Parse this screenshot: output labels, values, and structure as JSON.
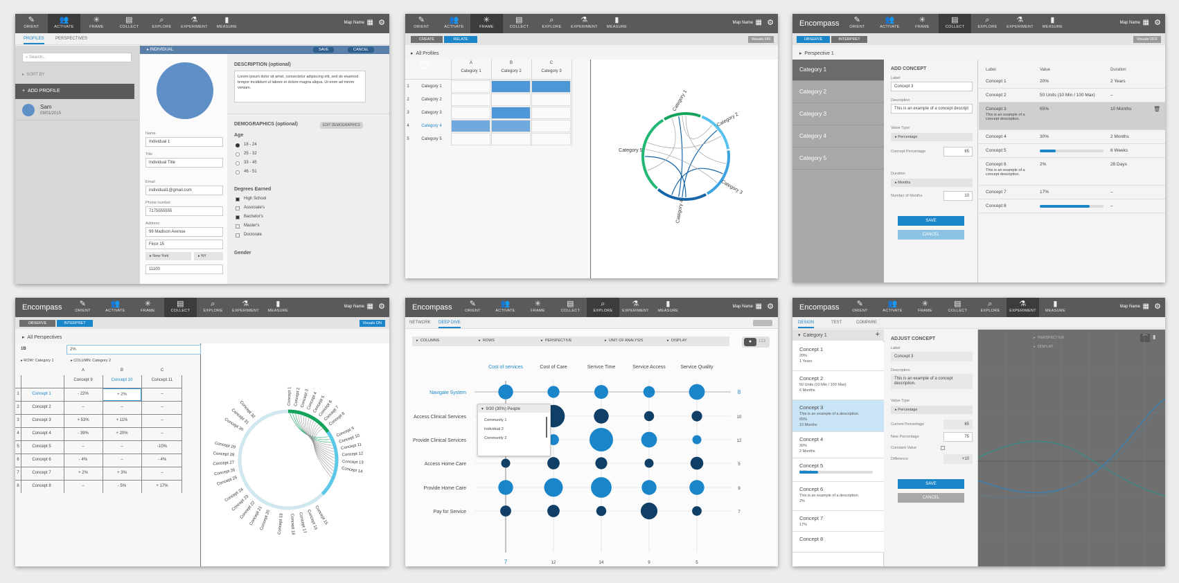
{
  "brand": "Encompass",
  "map_name": "Map Name",
  "tools": [
    "ORIENT",
    "ACTIVATE",
    "FRAME",
    "COLLECT",
    "EXPLORE",
    "EXPERIMENT",
    "MEASURE"
  ],
  "p1": {
    "tabs": [
      "PROFILES",
      "PERSPECTIVES"
    ],
    "search_placeholder": "Search...",
    "sort_by": "SORT BY",
    "add_profile": "ADD PROFILE",
    "profile_name": "Sam",
    "profile_date": "09/01/2015",
    "header": "INDIVIDUAL",
    "save": "SAVE",
    "cancel": "CANCEL",
    "name_label": "Name",
    "name_value": "Individual 1",
    "title_label": "Title",
    "title_value": "Individual Title",
    "email_label": "Email",
    "email_value": "individual1@gmail.com",
    "phone_label": "Phone number",
    "phone_value": "7175555555",
    "address_label": "Address",
    "address1": "99 Madison Avenue",
    "address2": "Floor 15",
    "city": "New York",
    "state": "NY",
    "zip": "11100",
    "desc_label": "DESCRIPTION (optional)",
    "desc_text": "Lorem ipsum dolor sit amet, consectetur adipiscing elit, sed do eiusmod tempor incididunt ut labore et dolore magna aliqua. Ut enim ad minim veniam.",
    "demo_label": "DEMOGRAPHICS (optional)",
    "edit_demo": "EDIT DEMOGRAPHICS",
    "age_label": "Age",
    "ages": [
      "18 - 24",
      "25 - 32",
      "33 - 45",
      "46 - 51"
    ],
    "degrees_label": "Degrees Earned",
    "degrees": [
      "High School",
      "Associate's",
      "Bachelor's",
      "Master's",
      "Doctorate"
    ],
    "gender_label": "Gender"
  },
  "p2": {
    "steps": [
      "CREATE",
      "RELATE"
    ],
    "visuals": "Visuals ON",
    "all_profiles": "All Profiles",
    "cols": [
      "A",
      "B",
      "C"
    ],
    "col_names": [
      "Category 1",
      "Category 2",
      "Category 3"
    ],
    "rows": [
      "Category 1",
      "Category 2",
      "Category 3",
      "Category 4",
      "Category 5"
    ],
    "row_nums": [
      "1",
      "2",
      "3",
      "4",
      "5"
    ],
    "chord_labels": [
      "Category 1",
      "Category 2",
      "Category 3",
      "Category 4",
      "Category 5"
    ]
  },
  "p3": {
    "steps": [
      "OBSERVE",
      "INTERPRET"
    ],
    "visuals": "Visuals OFF",
    "perspective": "Perspective 1",
    "categories": [
      "Category 1",
      "Category 2",
      "Category 3",
      "Category 4",
      "Category 5"
    ],
    "add_concept": "ADD CONCEPT",
    "label_label": "Label",
    "label_value": "Concept 3",
    "desc_label": "Description",
    "desc_value": "This is an example of a concept descript",
    "vt_label": "Value Type",
    "vt_value": "Percentage",
    "cp_label": "Concept Percentage",
    "cp_value": "65",
    "dur_label": "Duration",
    "dur_value": "Months",
    "num_label": "Number of Months",
    "num_value": "10",
    "save": "SAVE",
    "cancel": "CANCEL",
    "th": [
      "Label",
      "Value",
      "Duration"
    ],
    "rows": [
      {
        "label": "Concept 1",
        "value": "20%",
        "dur": "2 Years"
      },
      {
        "label": "Concept 2",
        "value": "50 Units (10 Min / 100 Max)",
        "dur": "–"
      },
      {
        "label": "Concept 3",
        "sub": "This is an example of a concept description.",
        "value": "65%",
        "dur": "10 Months"
      },
      {
        "label": "Concept 4",
        "value": "30%",
        "dur": "2 Months"
      },
      {
        "label": "Concept 5",
        "value": "",
        "dur": "6 Weeks",
        "bar": 0.25
      },
      {
        "label": "Concept 6",
        "sub": "This is an example of a concept description.",
        "value": "2%",
        "dur": "28 Days"
      },
      {
        "label": "Concept 7",
        "value": "17%",
        "dur": "–"
      },
      {
        "label": "Concept 8",
        "value": "",
        "dur": "–",
        "bar": 0.78
      }
    ]
  },
  "p4": {
    "steps": [
      "OBSERVE",
      "INTERPRET"
    ],
    "visuals": "Visuals ON",
    "all_persp": "All Perspectives",
    "cell_ref": "1B",
    "cell_val": "2%",
    "row_sel": "ROW: Category 1",
    "col_sel": "COLUMN: Category 2",
    "cols": [
      "A",
      "B",
      "C"
    ],
    "col_names": [
      "Concept 9",
      "Concept 10",
      "Concept 11"
    ],
    "rows": [
      {
        "n": "1",
        "name": "Concept 1",
        "v": [
          "- 22%",
          "+ 2%",
          "–"
        ]
      },
      {
        "n": "2",
        "name": "Concept 2",
        "v": [
          "–",
          "–",
          "–"
        ]
      },
      {
        "n": "3",
        "name": "Concept 3",
        "v": [
          "+ 53%",
          "+ 11%",
          "–"
        ]
      },
      {
        "n": "4",
        "name": "Concept 4",
        "v": [
          "- 39%",
          "+ 20%",
          "–"
        ]
      },
      {
        "n": "5",
        "name": "Concept 5",
        "v": [
          "–",
          "–",
          "-10%"
        ]
      },
      {
        "n": "6",
        "name": "Concept 6",
        "v": [
          "- 4%",
          "–",
          "- 4%"
        ]
      },
      {
        "n": "7",
        "name": "Concept 7",
        "v": [
          "+ 2%",
          "+ 3%",
          "–"
        ]
      },
      {
        "n": "8",
        "name": "Concept 8",
        "v": [
          "–",
          "- 5%",
          "+ 17%"
        ]
      }
    ],
    "radial": [
      "Concept 1",
      "Concept 2",
      "Concept 3",
      "Concept 4",
      "Concept 5",
      "Concept 6",
      "Concept 7",
      "Concept 8",
      "Concept 9",
      "Concept 10",
      "Concept 11",
      "Concept 12",
      "Concept 13",
      "Concept 14",
      "Concept 15",
      "Concept 16",
      "Concept 17",
      "Concept 18",
      "Concept 19",
      "Concept 20",
      "Concept 21",
      "Concept 22",
      "Concept 23",
      "Concept 24",
      "Concept 25",
      "Concept 26",
      "Concept 27",
      "Concept 28",
      "Concept 29",
      "Concept 30",
      "Concept 31",
      "Concept 32"
    ]
  },
  "p5": {
    "tabs": [
      "NETWORK",
      "DEEP DIVE"
    ],
    "filters": [
      "COLUMNS",
      "ROWS",
      "PERSPECTIVE",
      "UNIT OF ANALYSIS",
      "DISPLAY"
    ],
    "toggle_num": "123",
    "cols": [
      "Cost of services",
      "Cost of Care",
      "Serivce Time",
      "Service Access",
      "Service Quality"
    ],
    "rows": [
      "Navigate System",
      "Access Clinical Services",
      "Provide Clinical Services",
      "Access Home Care",
      "Provide Home Care",
      "Pay for Service"
    ],
    "row_counts": [
      "8",
      "10",
      "12",
      "5",
      "9",
      "7"
    ],
    "col_counts": [
      "7",
      "12",
      "14",
      "9",
      "5"
    ],
    "bubbles": [
      [
        0.55,
        0.4,
        0.5,
        0.38,
        0.6
      ],
      [
        0.35,
        0.95,
        0.55,
        0.3,
        0.33
      ],
      [
        0.45,
        0.35,
        1.0,
        0.6,
        0.25
      ],
      [
        0.25,
        0.42,
        0.4,
        0.25,
        0.45
      ],
      [
        0.55,
        0.75,
        0.85,
        0.55,
        0.55
      ],
      [
        0.35,
        0.42,
        0.3,
        0.65,
        0.28
      ]
    ],
    "dark": [
      [
        0,
        0,
        0,
        0,
        0
      ],
      [
        0,
        1,
        1,
        1,
        1
      ],
      [
        0,
        0,
        0,
        0,
        0
      ],
      [
        1,
        1,
        1,
        1,
        1
      ],
      [
        0,
        0,
        0,
        0,
        0
      ],
      [
        1,
        1,
        1,
        1,
        1
      ]
    ],
    "popup_title": "9/30 (30%) People",
    "popup_items": [
      "Community 1",
      "Individual 2",
      "Community 2"
    ]
  },
  "p6": {
    "tabs": [
      "DESIGN",
      "TEST",
      "COMPARE"
    ],
    "category": "Category 1",
    "list": [
      {
        "t": "Concept 1",
        "l": [
          "20%",
          "1 Years"
        ]
      },
      {
        "t": "Concept 2",
        "l": [
          "50 Units (10 Min / 100 Max)",
          "6 Months"
        ]
      },
      {
        "t": "Concept 3",
        "l": [
          "This is an example of a description.",
          "65%",
          "10 Months"
        ]
      },
      {
        "t": "Concept 4",
        "l": [
          "30%",
          "2 Months"
        ]
      },
      {
        "t": "Concept 5",
        "l": [
          "6 Weeks"
        ],
        "bar": 0.25
      },
      {
        "t": "Concept 6",
        "l": [
          "This is an example of a description.",
          "2%"
        ]
      },
      {
        "t": "Concept 7",
        "l": [
          "17%"
        ]
      },
      {
        "t": "Concept 8",
        "l": []
      }
    ],
    "adjust": "ADJUST CONCEPT",
    "label_label": "Label",
    "label_value": "Concept 3",
    "desc_label": "Description",
    "desc_value": "This is an example of a concept description.",
    "vt_label": "Value Type",
    "vt_value": "Percentage",
    "cur_label": "Current Percentage",
    "cur_value": "65",
    "new_label": "New Percentage",
    "new_value": "75",
    "const_label": "Constant Value",
    "diff_label": "Difference",
    "diff_value": "+10",
    "save": "SAVE",
    "cancel": "CANCEL",
    "persp": "PERSPECTIVE",
    "display": "DISPLAY"
  }
}
